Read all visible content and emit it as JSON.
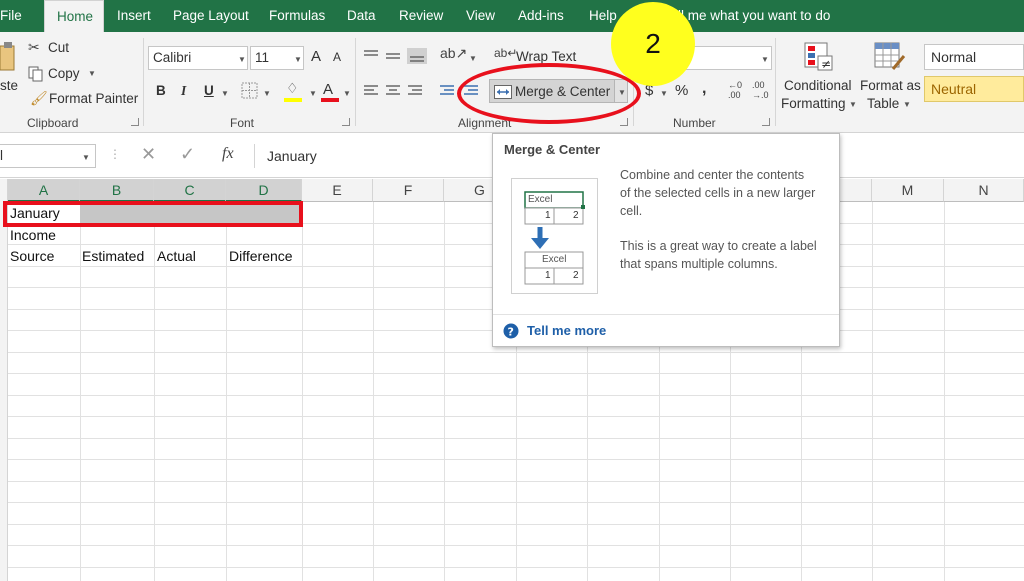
{
  "tabs": {
    "file": "File",
    "home": "Home",
    "insert": "Insert",
    "page_layout": "Page Layout",
    "formulas": "Formulas",
    "data": "Data",
    "review": "Review",
    "view": "View",
    "addins": "Add-ins",
    "help": "Help",
    "tell_me": "ll me what you want to do"
  },
  "clipboard": {
    "paste_partial": "ste",
    "cut": "Cut",
    "copy": "Copy",
    "format_painter": "Format Painter",
    "group_label": "Clipboard"
  },
  "font": {
    "name": "Calibri",
    "size": "11",
    "grow": "A",
    "shrink": "A",
    "bold": "B",
    "italic": "I",
    "underline": "U",
    "font_color_letter": "A",
    "group_label": "Font"
  },
  "alignment": {
    "wrap_text": "Wrap Text",
    "merge_center": "Merge & Center",
    "group_label": "Alignment"
  },
  "number": {
    "currency": "$",
    "percent": "%",
    "comma": ",",
    "group_label": "Number"
  },
  "styles": {
    "conditional_formatting": [
      "Conditional",
      "Formatting"
    ],
    "format_as_table": [
      "Format as",
      "Table"
    ],
    "normal": "Normal",
    "neutral": "Neutral"
  },
  "formula_bar": {
    "name_box_partial": "l",
    "fx": "fx",
    "content": "January"
  },
  "columns": [
    "A",
    "B",
    "C",
    "D",
    "E",
    "F",
    "G",
    "M",
    "N"
  ],
  "cells": {
    "a1": "January",
    "a2": "Income",
    "a3": "Source",
    "b3": "Estimated",
    "c3": "Actual",
    "d3": "Difference"
  },
  "tooltip": {
    "title": "Merge & Center",
    "desc1": [
      "Combine and center the contents",
      "of the selected cells in a new larger",
      "cell."
    ],
    "desc2": [
      "This is a great way to create a label",
      "that spans multiple columns."
    ],
    "illus_text": "Excel",
    "illus_n1": "1",
    "illus_n2": "2",
    "tell_more": "Tell me more"
  },
  "annotation": {
    "step": "2"
  },
  "colors": {
    "excel_green": "#217346",
    "annotation_red": "#e8101c",
    "badge_yellow": "#ffff1e",
    "neutral_fill": "#ffeb9c",
    "neutral_text": "#9c6500",
    "tooltip_title": "#444444",
    "link_blue": "#1e5fa8"
  }
}
